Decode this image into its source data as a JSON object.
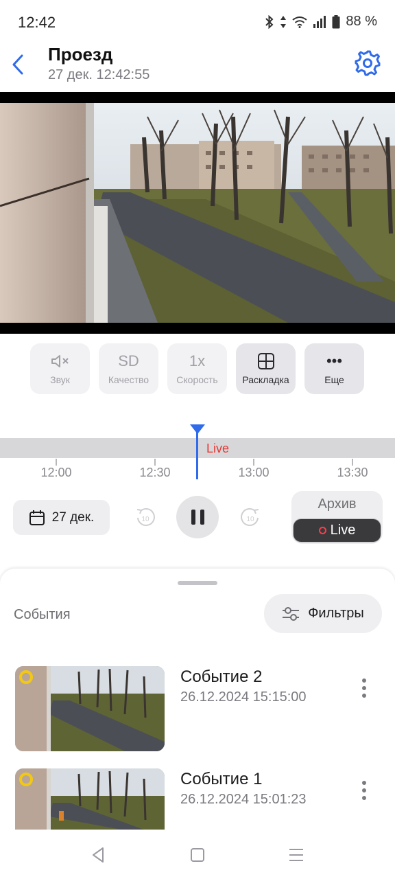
{
  "status_bar": {
    "time": "12:42",
    "battery": "88 %",
    "icons": [
      "bluetooth-icon",
      "data-arrows-icon",
      "wifi-icon",
      "signal-icon",
      "battery-icon"
    ]
  },
  "header": {
    "title": "Проезд",
    "subtitle": "27 дек. 12:42:55",
    "back_icon": "chevron-left-icon",
    "settings_icon": "gear-icon"
  },
  "video": {
    "pager": {
      "count": 3,
      "active_index": 0
    }
  },
  "controls": [
    {
      "key": "sound",
      "icon_text": "",
      "label": "Звук",
      "active": false
    },
    {
      "key": "quality",
      "icon_text": "SD",
      "label": "Качество",
      "active": false
    },
    {
      "key": "speed",
      "icon_text": "1x",
      "label": "Скорость",
      "active": false
    },
    {
      "key": "layout",
      "icon_text": "",
      "label": "Раскладка",
      "active": true
    },
    {
      "key": "more",
      "icon_text": "•••",
      "label": "Еще",
      "active": true
    }
  ],
  "timeline": {
    "live_label": "Live",
    "ticks": [
      "12:00",
      "12:30",
      "13:00",
      "13:30"
    ]
  },
  "playback": {
    "date_label": "27 дек.",
    "rewind_seconds": "10",
    "forward_seconds": "10",
    "mode_archive": "Архив",
    "mode_live": "Live"
  },
  "events_sheet": {
    "title": "События",
    "filter_label": "Фильтры",
    "items": [
      {
        "title": "Событие 2",
        "timestamp": "26.12.2024 15:15:00"
      },
      {
        "title": "Событие 1",
        "timestamp": "26.12.2024 15:01:23"
      }
    ]
  },
  "colors": {
    "accent": "#2f6bea",
    "live_red": "#e53935",
    "event_marker": "#f2c814"
  }
}
